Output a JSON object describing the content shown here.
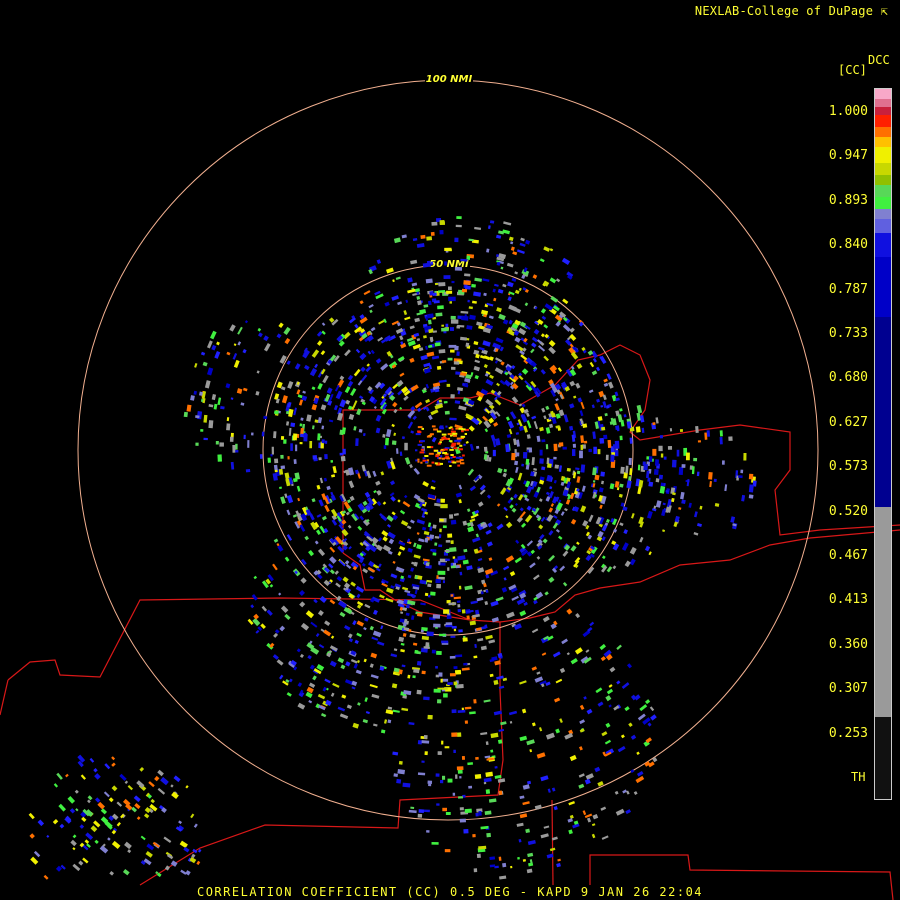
{
  "header": {
    "credit": "NEXLAB-College of DuPage",
    "credit_icon": "external-link-icon"
  },
  "legend": {
    "product_code": "DCC",
    "units": "[CC]",
    "ticks": [
      "1.000",
      "0.947",
      "0.893",
      "0.840",
      "0.787",
      "0.733",
      "0.680",
      "0.627",
      "0.573",
      "0.520",
      "0.467",
      "0.413",
      "0.360",
      "0.307",
      "0.253"
    ],
    "th_label": "TH",
    "colors": [
      "#f8a8c8",
      "#e07090",
      "#c8203c",
      "#ff2000",
      "#ff7000",
      "#ffc000",
      "#f0f000",
      "#c8d800",
      "#90c000",
      "#58d858",
      "#40f040",
      "#8080d0",
      "#6060e0",
      "#1010e0",
      "#0000c8",
      "#000090",
      "#9a9a9a",
      "#111111"
    ]
  },
  "rings": [
    {
      "label": "100 NMI",
      "range_nmi": 100
    },
    {
      "label": "50 NMI",
      "range_nmi": 50
    }
  ],
  "footer": {
    "caption": "CORRELATION COEFFICIENT (CC) 0.5 DEG - KAPD 9 JAN 26 22:04"
  }
}
